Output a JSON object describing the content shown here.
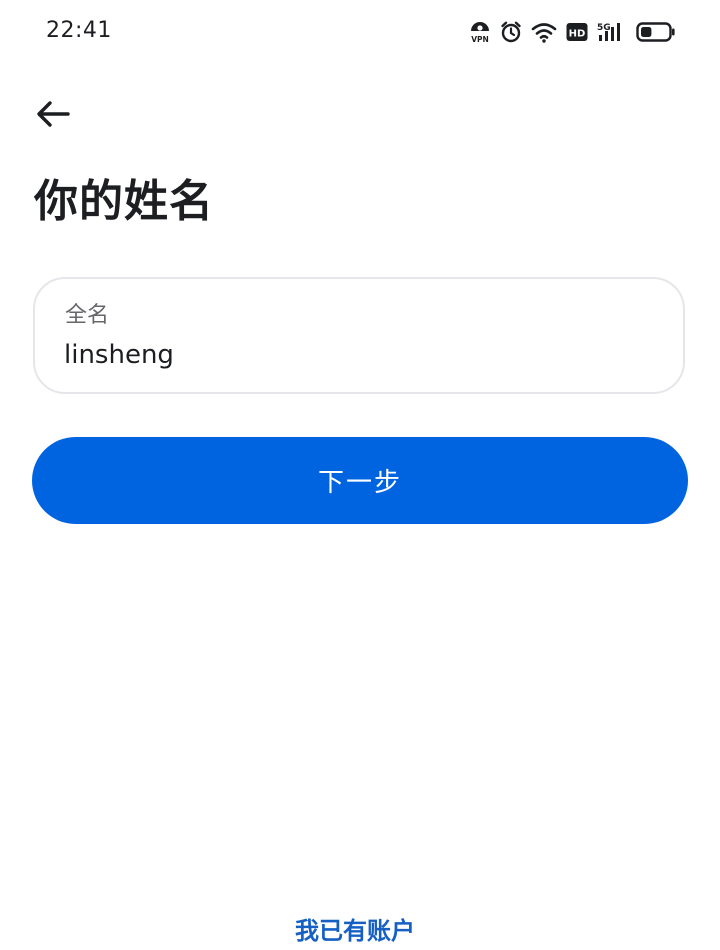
{
  "status_bar": {
    "time": "22:41",
    "icons": [
      "vpn-icon",
      "alarm-icon",
      "wifi-icon",
      "hd-icon",
      "signal-5g-icon",
      "battery-icon"
    ],
    "vpn_text": "VPN",
    "hd_text": "HD",
    "network_text": "5G",
    "battery_level": 0.4
  },
  "header": {
    "back_icon": "arrow-left-icon"
  },
  "page": {
    "title": "你的姓名"
  },
  "name_field": {
    "label": "全名",
    "value": "linsheng"
  },
  "actions": {
    "next_label": "下一步",
    "have_account_label": "我已有账户"
  },
  "colors": {
    "primary": "#0064e0",
    "link": "#1660c4",
    "text": "#1c1e21",
    "secondary_text": "#65676b",
    "border": "#e4e6ea"
  }
}
